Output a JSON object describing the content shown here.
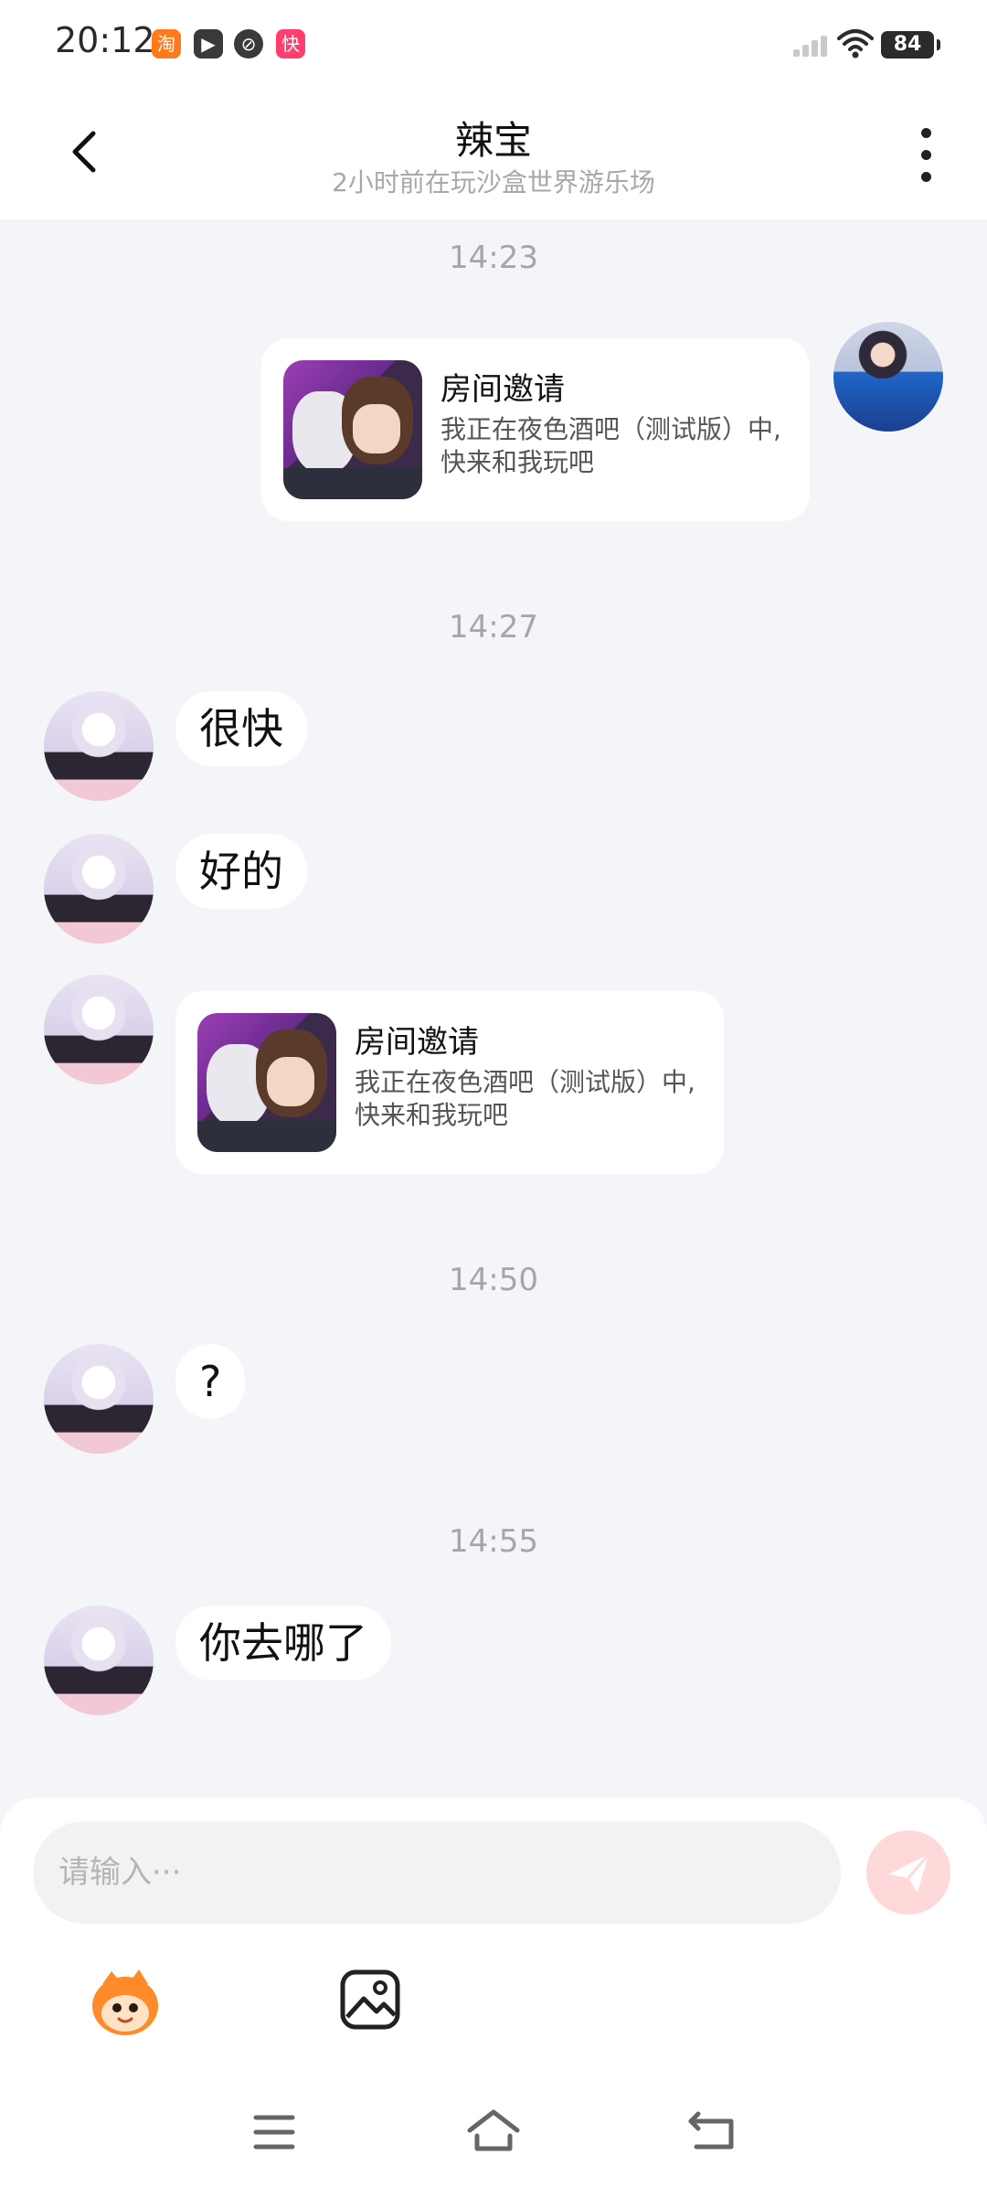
{
  "status_bar": {
    "time": "20:12",
    "apps": [
      "淘",
      "▶",
      "⊘",
      "快"
    ],
    "battery": "84"
  },
  "header": {
    "title": "辣宝",
    "subtitle": "2小时前在玩沙盒世界游乐场"
  },
  "messages": {
    "time_1": "14:23",
    "invite_1": {
      "title": "房间邀请",
      "desc": "我正在夜色酒吧（测试版）中, 快来和我玩吧"
    },
    "time_2": "14:27",
    "text_1": "很快",
    "text_2": "好的",
    "invite_2": {
      "title": "房间邀请",
      "desc": "我正在夜色酒吧（测试版）中, 快来和我玩吧"
    },
    "time_3": "14:50",
    "text_3": "?",
    "time_4": "14:55",
    "text_4": "你去哪了"
  },
  "composer": {
    "placeholder": "请输入···"
  },
  "colors": {
    "chat_bg": "#f3f5f9",
    "send_button": "#ffd9d9",
    "accent": "#ff7a1a"
  }
}
